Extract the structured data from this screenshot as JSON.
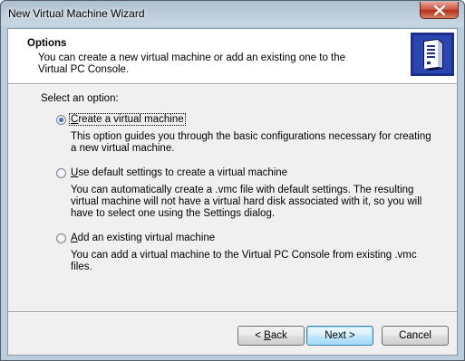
{
  "window": {
    "title": "New Virtual Machine Wizard"
  },
  "header": {
    "title": "Options",
    "description": "You can create a new virtual machine or add an existing one to the Virtual PC Console."
  },
  "body": {
    "select_label": "Select an option:",
    "options": [
      {
        "selected": true,
        "mnemonic": "C",
        "label_rest": "reate a virtual machine",
        "description": "This option guides you through the basic configurations necessary for creating a new virtual machine."
      },
      {
        "selected": false,
        "mnemonic": "U",
        "label_rest": "se default settings to create a virtual machine",
        "description": "You can automatically create a .vmc file with default settings. The resulting virtual machine will not have a virtual hard disk associated with it, so you will have to select one using the Settings dialog."
      },
      {
        "selected": false,
        "mnemonic": "A",
        "label_rest": "dd an existing virtual machine",
        "description": "You can add a virtual machine to the Virtual PC Console from existing .vmc files."
      }
    ]
  },
  "buttons": {
    "back_prefix": "< ",
    "back_mnemonic": "B",
    "back_rest": "ack",
    "next": "Next >",
    "cancel": "Cancel"
  },
  "icons": {
    "close": "close-icon",
    "header": "virtual-pc-computer-icon"
  },
  "colors": {
    "accent_blue": "#1c2f8c",
    "default_button_border": "#3c7fb1",
    "close_button": "#c4482f"
  }
}
